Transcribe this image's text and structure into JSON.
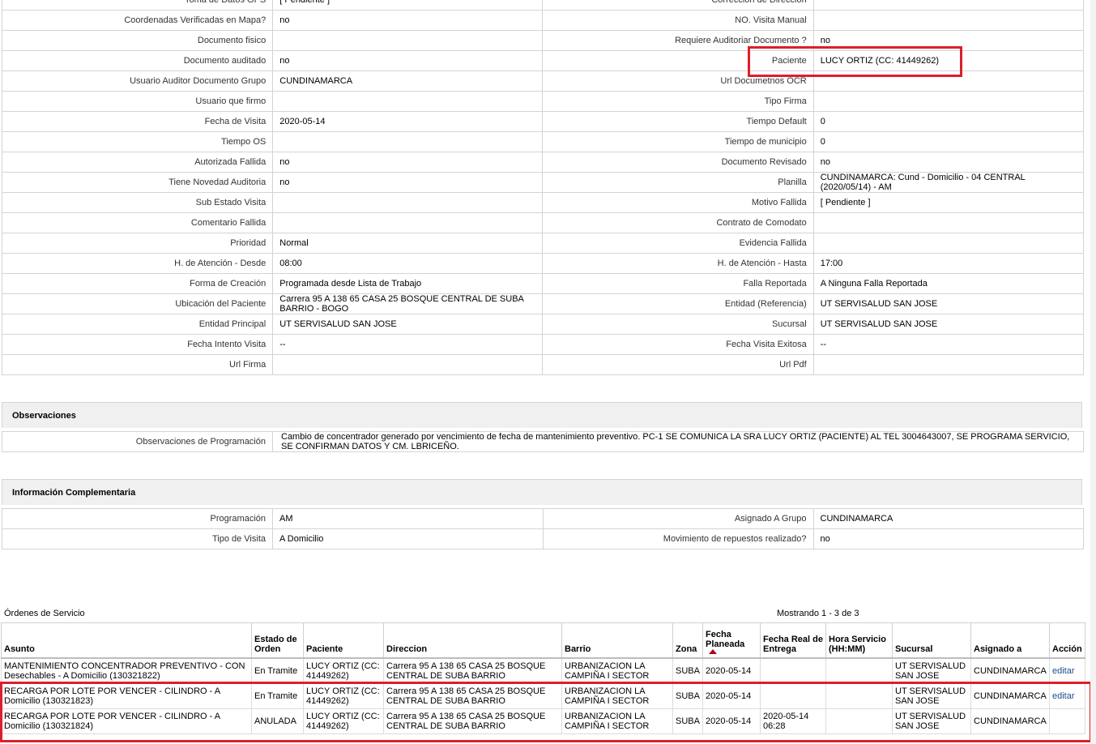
{
  "detail_rows": [
    {
      "l1": "Toma de Datos GPS",
      "v1": "[ Pendiente ]",
      "l2": "Correccion de Direccion",
      "v2": ""
    },
    {
      "l1": "Coordenadas Verificadas en Mapa?",
      "v1": "no",
      "l2": "NO. Visita Manual",
      "v2": ""
    },
    {
      "l1": "Documento fisico",
      "v1": "",
      "l2": "Requiere Auditoriar Documento ?",
      "v2": "no"
    },
    {
      "l1": "Documento auditado",
      "v1": "no",
      "l2": "Paciente",
      "v2": "LUCY ORTIZ (CC: 41449262)"
    },
    {
      "l1": "Usuario Auditor Documento Grupo",
      "v1": "CUNDINAMARCA",
      "l2": "Url Documetnos OCR",
      "v2": ""
    },
    {
      "l1": "Usuario que firmo",
      "v1": "",
      "l2": "Tipo Firma",
      "v2": ""
    },
    {
      "l1": "Fecha de Visita",
      "v1": "2020-05-14",
      "l2": "Tiempo Default",
      "v2": "0"
    },
    {
      "l1": "Tiempo OS",
      "v1": "",
      "l2": "Tiempo de municipio",
      "v2": "0"
    },
    {
      "l1": "Autorizada Fallida",
      "v1": "no",
      "l2": "Documento Revisado",
      "v2": "no"
    },
    {
      "l1": "Tiene Novedad Auditoria",
      "v1": "no",
      "l2": "Planilla",
      "v2": "CUNDINAMARCA: Cund - Domicilio - 04 CENTRAL (2020/05/14) - AM"
    },
    {
      "l1": "Sub Estado Visita",
      "v1": "",
      "l2": "Motivo Fallida",
      "v2": "[ Pendiente ]"
    },
    {
      "l1": "Comentario Fallida",
      "v1": "",
      "l2": "Contrato de Comodato",
      "v2": ""
    },
    {
      "l1": "Prioridad",
      "v1": "Normal",
      "l2": "Evidencia Fallida",
      "v2": ""
    },
    {
      "l1": "H. de Atención - Desde",
      "v1": "08:00",
      "l2": "H. de Atención - Hasta",
      "v2": "17:00"
    },
    {
      "l1": "Forma de Creación",
      "v1": "Programada desde Lista de Trabajo",
      "l2": "Falla Reportada",
      "v2": "A Ninguna Falla Reportada"
    },
    {
      "l1": "Ubicación del Paciente",
      "v1": "Carrera 95 A 138 65 CASA 25 BOSQUE CENTRAL DE SUBA BARRIO - BOGO",
      "l2": "Entidad (Referencia)",
      "v2": "UT SERVISALUD SAN JOSE"
    },
    {
      "l1": "Entidad Principal",
      "v1": "UT SERVISALUD SAN JOSE",
      "l2": "Sucursal",
      "v2": "UT SERVISALUD SAN JOSE"
    },
    {
      "l1": "Fecha Intento Visita",
      "v1": "--",
      "l2": "Fecha Visita Exitosa",
      "v2": "--"
    },
    {
      "l1": "Url Firma",
      "v1": "",
      "l2": "Url Pdf",
      "v2": ""
    }
  ],
  "observaciones": {
    "title": "Observaciones",
    "label": "Observaciones de Programación",
    "value": "Cambio de concentrador generado por vencimiento de fecha de mantenimiento preventivo. PC-1 SE COMUNICA LA SRA LUCY ORTIZ (PACIENTE) AL TEL 3004643007, SE PROGRAMA SERVICIO, SE CONFIRMAN DATOS Y CM. LBRICEÑO."
  },
  "complementaria": {
    "title": "Información Complementaria",
    "rows": [
      {
        "l1": "Programación",
        "v1": "AM",
        "l2": "Asignado A Grupo",
        "v2": "CUNDINAMARCA"
      },
      {
        "l1": "Tipo de Visita",
        "v1": "A Domicilio",
        "l2": "Movimiento de repuestos realizado?",
        "v2": "no"
      }
    ]
  },
  "ordenes": {
    "title": "Órdenes de Servicio",
    "count": "Mostrando 1 - 3 de 3",
    "headers": [
      "Asunto",
      "Estado de Orden",
      "Paciente",
      "Direccion",
      "Barrio",
      "Zona",
      "Fecha Planeada",
      "Fecha Real de Entrega",
      "Hora Servicio (HH:MM)",
      "Sucursal",
      "Asignado a",
      "Acción"
    ],
    "rows": [
      [
        "MANTENIMIENTO CONCENTRADOR PREVENTIVO - CON Desechables - A Domicilio (130321822)",
        "En Tramite",
        "LUCY ORTIZ (CC: 41449262)",
        "Carrera 95 A 138 65 CASA 25 BOSQUE CENTRAL DE SUBA BARRIO",
        "URBANIZACION LA CAMPIÑA I SECTOR",
        "SUBA",
        "2020-05-14",
        "",
        "",
        "UT SERVISALUD SAN JOSE",
        "CUNDINAMARCA",
        "editar"
      ],
      [
        "RECARGA POR LOTE POR VENCER - CILINDRO - A Domicilio (130321823)",
        "En Tramite",
        "LUCY ORTIZ (CC: 41449262)",
        "Carrera 95 A 138 65 CASA 25 BOSQUE CENTRAL DE SUBA BARRIO",
        "URBANIZACION LA CAMPIÑA I SECTOR",
        "SUBA",
        "2020-05-14",
        "",
        "",
        "UT SERVISALUD SAN JOSE",
        "CUNDINAMARCA",
        "editar"
      ],
      [
        "RECARGA POR LOTE POR VENCER - CILINDRO - A Domicilio (130321824)",
        "ANULADA",
        "LUCY ORTIZ (CC: 41449262)",
        "Carrera 95 A 138 65 CASA 25 BOSQUE CENTRAL DE SUBA BARRIO",
        "URBANIZACION LA CAMPIÑA I SECTOR",
        "SUBA",
        "2020-05-14",
        "2020-05-14 06:28",
        "",
        "UT SERVISALUD SAN JOSE",
        "CUNDINAMARCA",
        ""
      ]
    ]
  },
  "colors": {
    "highlight": "#dc1f2a",
    "link": "#1a4f8a",
    "border": "#d4d4d4",
    "section_bg": "#f0f0f0"
  }
}
